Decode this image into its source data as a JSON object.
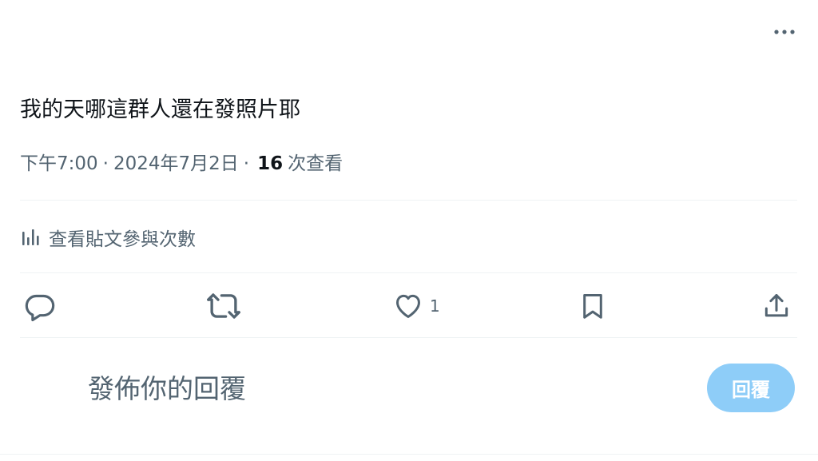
{
  "header": {
    "more_icon": "more-horizontal-icon"
  },
  "tweet": {
    "text": "我的天哪這群人還在發照片耶",
    "time": "下午7:00",
    "separator": "·",
    "date": "2024年7月2日",
    "views_count": "16",
    "views_label": "次查看"
  },
  "engagement": {
    "icon": "analytics-icon",
    "label": "查看貼文參與次數"
  },
  "actions": {
    "reply_icon": "reply-icon",
    "retweet_icon": "retweet-icon",
    "like_icon": "heart-icon",
    "like_count": "1",
    "bookmark_icon": "bookmark-icon",
    "share_icon": "share-icon"
  },
  "reply_box": {
    "placeholder": "發佈你的回覆",
    "button_label": "回覆"
  },
  "colors": {
    "text_primary": "#0f1419",
    "text_secondary": "#536471",
    "divider": "#eff3f4",
    "reply_button_disabled": "#8ecdf8"
  }
}
